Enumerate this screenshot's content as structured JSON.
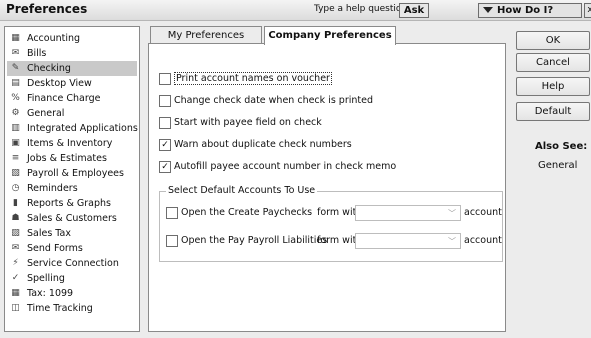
{
  "window": {
    "title": "Preferences"
  },
  "help": {
    "prompt": "Type a help question",
    "ask_label": "Ask",
    "howdoi_label": "How Do I?",
    "close_label": "x"
  },
  "sidebar": {
    "items": [
      {
        "label": "Accounting",
        "icon": "accounting-icon"
      },
      {
        "label": "Bills",
        "icon": "bills-icon"
      },
      {
        "label": "Checking",
        "icon": "checking-icon",
        "selected": true
      },
      {
        "label": "Desktop View",
        "icon": "desktop-view-icon"
      },
      {
        "label": "Finance Charge",
        "icon": "finance-charge-icon"
      },
      {
        "label": "General",
        "icon": "general-icon"
      },
      {
        "label": "Integrated Applications",
        "icon": "integrated-apps-icon"
      },
      {
        "label": "Items & Inventory",
        "icon": "items-inventory-icon"
      },
      {
        "label": "Jobs & Estimates",
        "icon": "jobs-estimates-icon"
      },
      {
        "label": "Payroll & Employees",
        "icon": "payroll-icon"
      },
      {
        "label": "Reminders",
        "icon": "reminders-icon"
      },
      {
        "label": "Reports & Graphs",
        "icon": "reports-graphs-icon"
      },
      {
        "label": "Sales & Customers",
        "icon": "sales-customers-icon"
      },
      {
        "label": "Sales Tax",
        "icon": "sales-tax-icon"
      },
      {
        "label": "Send Forms",
        "icon": "send-forms-icon"
      },
      {
        "label": "Service Connection",
        "icon": "service-connection-icon"
      },
      {
        "label": "Spelling",
        "icon": "spelling-icon"
      },
      {
        "label": "Tax: 1099",
        "icon": "tax-1099-icon"
      },
      {
        "label": "Time Tracking",
        "icon": "time-tracking-icon"
      }
    ]
  },
  "tabs": {
    "my_prefs": "My Preferences",
    "company_prefs": "Company Preferences",
    "active": "company_prefs"
  },
  "options": [
    {
      "label": "Print account names on voucher",
      "checked": false
    },
    {
      "label": "Change check date when check is printed",
      "checked": false
    },
    {
      "label": "Start with payee field on check",
      "checked": false
    },
    {
      "label": "Warn about duplicate check numbers",
      "checked": true
    },
    {
      "label": "Autofill payee account number in check memo",
      "checked": true
    }
  ],
  "default_accounts": {
    "title": "Select Default Accounts To Use",
    "rows": [
      {
        "label": "Open the Create Paychecks",
        "form_with": "form with",
        "account_label": "account",
        "value": ""
      },
      {
        "label": "Open the Pay Payroll Liabilities",
        "form_with": "form with",
        "account_label": "account",
        "value": ""
      }
    ]
  },
  "buttons": {
    "ok": "OK",
    "cancel": "Cancel",
    "help": "Help",
    "default": "Default"
  },
  "also_see": {
    "title": "Also See:",
    "links": [
      "General"
    ]
  }
}
